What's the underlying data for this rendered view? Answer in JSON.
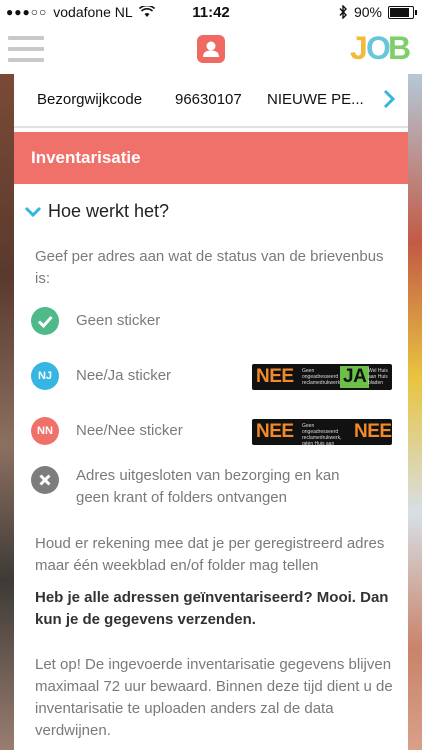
{
  "status_bar": {
    "signal": "●●●○○",
    "carrier": "vodafone NL",
    "time": "11:42",
    "battery": "90%",
    "battery_level": 0.9
  },
  "navbar": {
    "menu_icon": "hamburger-icon",
    "user_icon": "user-icon",
    "logo_letters": [
      "J",
      "O",
      "B"
    ]
  },
  "route": {
    "label": "Bezorgwijkcode",
    "code": "96630107",
    "name": "NIEUWE PE...",
    "next_icon": "chevron-right-icon"
  },
  "section": {
    "title": "Inventarisatie"
  },
  "accordion": {
    "title": "Hoe werkt het?"
  },
  "intro": "Geef per adres aan wat de status van de brievenbus is:",
  "statuses": [
    {
      "badge": "",
      "label": "Geen sticker",
      "color": "#4fb98a",
      "icon": "check-icon"
    },
    {
      "badge": "NJ",
      "label": "Nee/Ja sticker",
      "color": "#36b5e2",
      "sticker_left": "NEE",
      "sticker_right": "JA",
      "sticker_text_left": "Geen ongeadresseerd reclamedrukwerk",
      "sticker_text_right": "Wel Huis aan Huis bladen"
    },
    {
      "badge": "NN",
      "label": "Nee/Nee sticker",
      "color": "#f0706a",
      "sticker_left": "NEE",
      "sticker_right": "NEE",
      "sticker_text_left": "Geen ongeadresseerd reclamedrukwerk, géén Huis aan Huisbladen",
      "sticker_text_right": ""
    },
    {
      "badge": "",
      "label": "Adres uitgesloten van bezorging en kan geen krant of folders ontvangen",
      "color": "#7d7d7d",
      "icon": "close-icon"
    }
  ],
  "note": "Houd er rekening mee dat je per geregistreerd adres maar één weekblad en/of folder mag tellen",
  "prompt_bold": "Heb je alle adressen geïnventariseerd? Mooi. Dan kun je de gegevens verzenden.",
  "warning": "Let op! De ingevoerde inventarisatie gegevens blijven maximaal 72 uur bewaard. Binnen deze tijd dient u de inventarisatie te uploaden anders zal de data verdwijnen.",
  "colors": {
    "accent": "#f0706a",
    "link": "#36b5e2"
  }
}
